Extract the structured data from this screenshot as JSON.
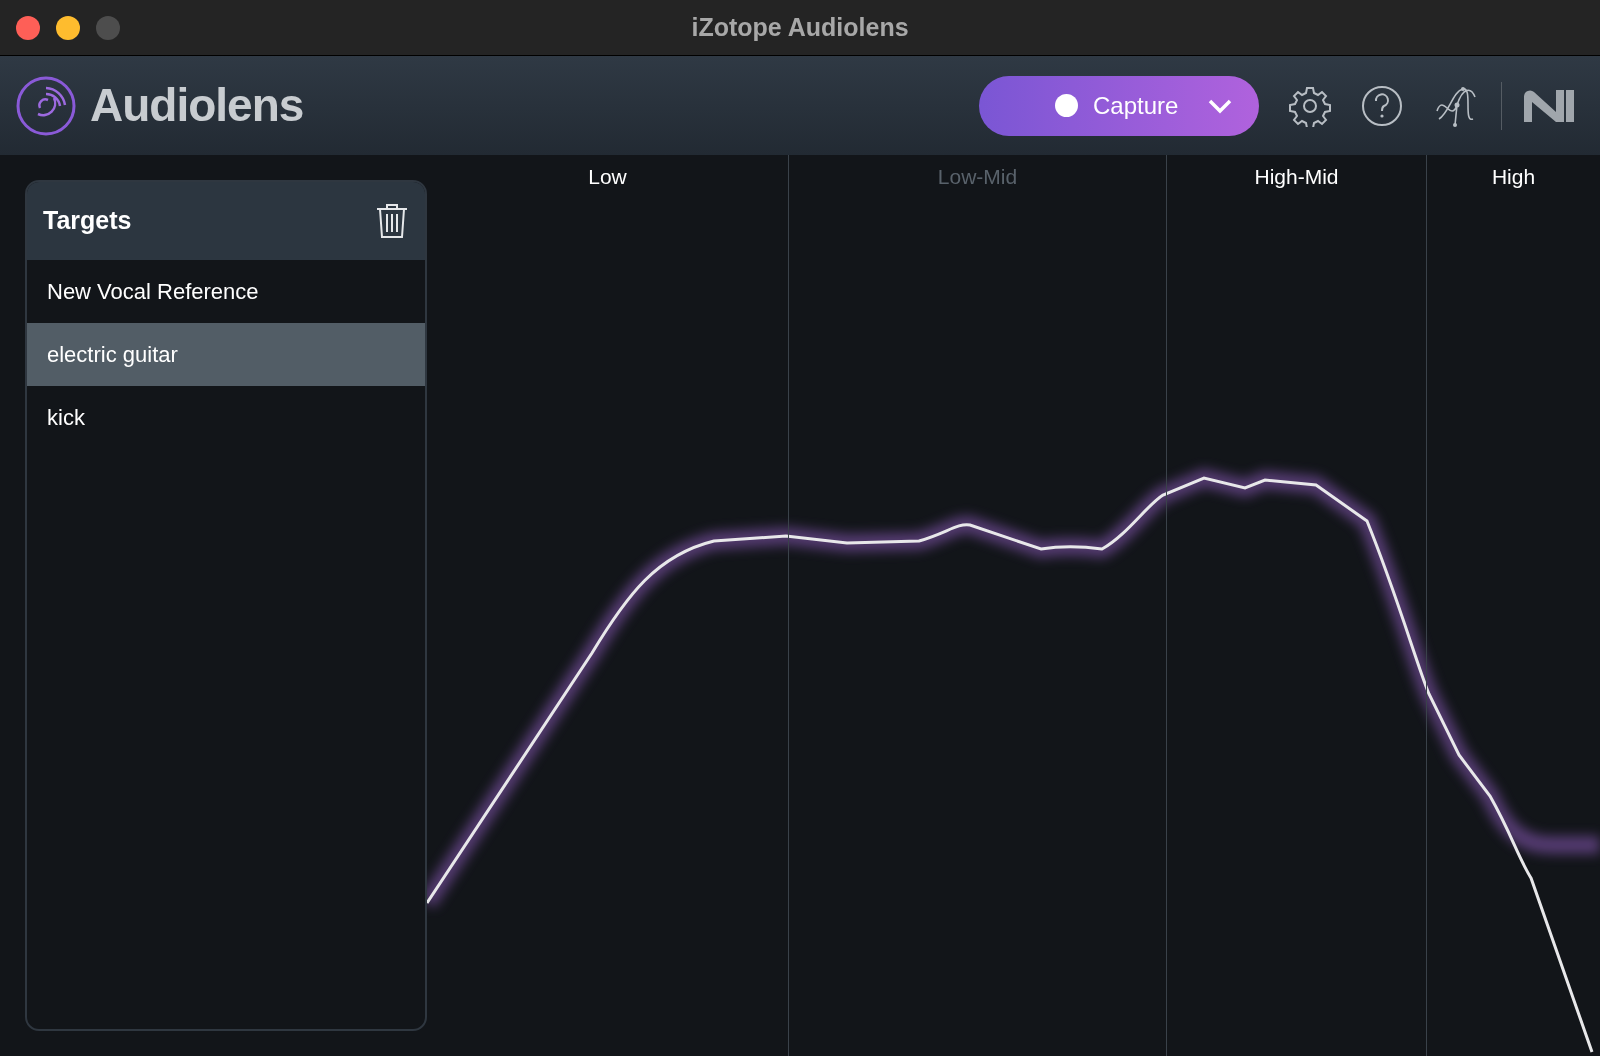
{
  "window": {
    "title": "iZotope Audiolens"
  },
  "header": {
    "app_name": "Audiolens",
    "capture_button": {
      "label": "Capture"
    }
  },
  "targets": {
    "title": "Targets",
    "items": [
      {
        "label": "New Vocal Reference",
        "selected": false
      },
      {
        "label": "electric guitar",
        "selected": true
      },
      {
        "label": "kick",
        "selected": false
      }
    ]
  },
  "bands": [
    {
      "label": "Low",
      "active": true
    },
    {
      "label": "Low-Mid",
      "active": false
    },
    {
      "label": "High-Mid",
      "active": true
    },
    {
      "label": "High",
      "active": true
    }
  ]
}
